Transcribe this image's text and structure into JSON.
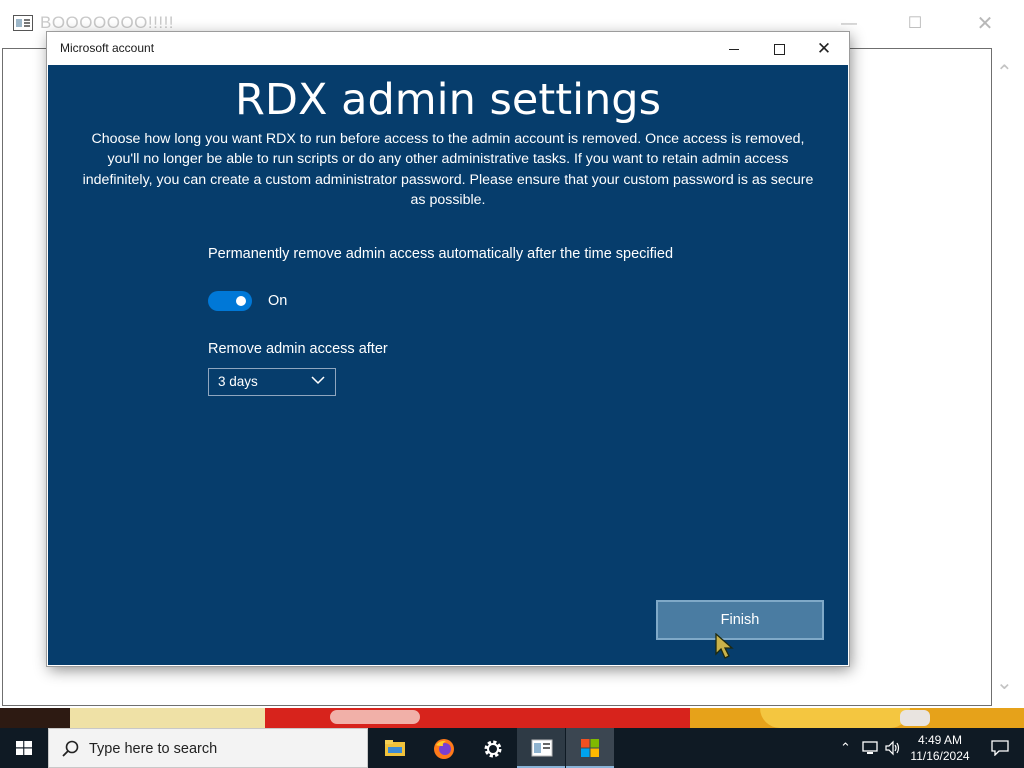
{
  "background_window": {
    "title": "BOOOOOOO!!!!!"
  },
  "dialog": {
    "title": "Microsoft account",
    "heading": "RDX admin settings",
    "description": "Choose how long you want RDX to run before access to the admin account is removed. Once access is removed, you'll no longer be able to run scripts or do any other administrative tasks. If you want to retain admin access indefinitely, you can create a custom administrator password. Please ensure that your custom password is as secure as possible.",
    "toggle": {
      "label": "Permanently remove admin access automatically after the time specified",
      "state_text": "On",
      "on": true
    },
    "duration": {
      "label": "Remove admin access after",
      "selected": "3 days"
    },
    "finish_label": "Finish"
  },
  "colors": {
    "dialog_background": "#063d6c",
    "toggle_on": "#0078d7",
    "finish_button": "#4a7ca2",
    "taskbar": "#0f1a24"
  },
  "taskbar": {
    "search_placeholder": "Type here to search",
    "apps": [
      "file-explorer-icon",
      "firefox-icon",
      "settings-icon",
      "app-window-icon",
      "store-icon"
    ],
    "time": "4:49 AM",
    "date": "11/16/2024"
  }
}
